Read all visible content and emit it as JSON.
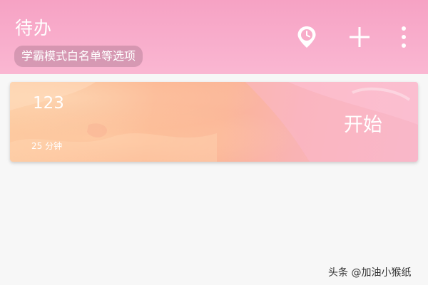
{
  "header": {
    "title": "待办",
    "options_chip": "学霸模式白名单等选项",
    "timer_icon": "clock-pin-icon",
    "add_icon": "plus-icon",
    "more_icon": "more-vertical-icon"
  },
  "tasks": [
    {
      "name": "123",
      "duration": "25 分钟",
      "start_label": "开始"
    }
  ],
  "watermark": "头条 @加油小猴纸",
  "colors": {
    "header_top": "#f6a2c4",
    "header_bottom": "#fab7d2",
    "card_warm": "#fbb08c",
    "card_pink": "#f8b7c6",
    "background": "#f7f7f7"
  }
}
